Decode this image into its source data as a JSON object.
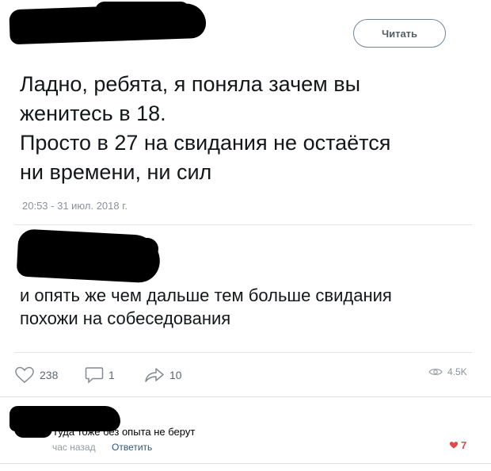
{
  "tweet": {
    "read_button": "Читать",
    "text": "Ладно, ребята, я поняла зачем вы\nженитесь в 18.\nПросто в 27 на свидания не остаётся\nни времени, ни сил",
    "timestamp": "20:53 - 31 июл. 2018 г."
  },
  "reply": {
    "text": "и опять же чем дальше тем больше свидания\nпохожи на собеседования",
    "likes": "238",
    "comments": "1",
    "shares": "10",
    "views": "4.5K"
  },
  "comment": {
    "text": "Туда тоже без опыта не берут",
    "time": "час назад",
    "reply_label": "Ответить",
    "likes": "7"
  },
  "colors": {
    "like_red": "#e64646",
    "link_blue": "#2a5885"
  },
  "icons": [
    "heart-icon",
    "comment-icon",
    "share-icon",
    "eye-icon"
  ]
}
